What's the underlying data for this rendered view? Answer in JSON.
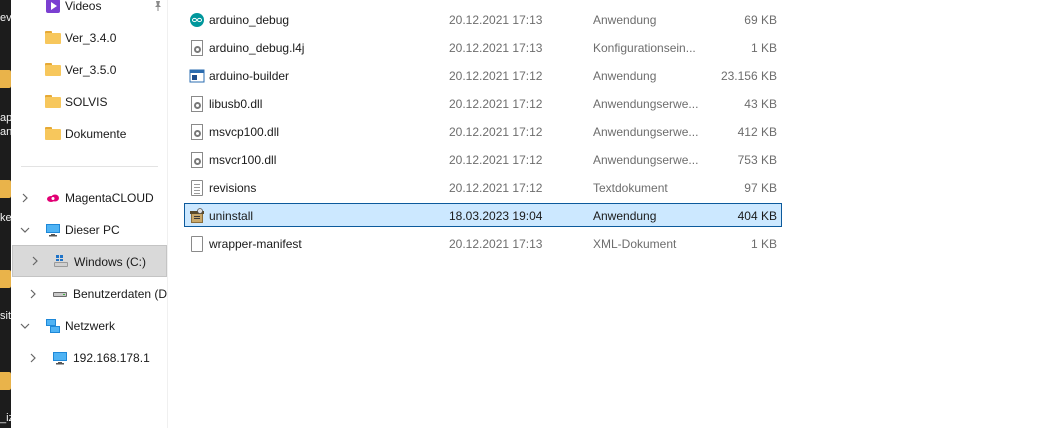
{
  "desktop": {
    "edge_text": [
      "ev",
      "ap",
      "an",
      "ke",
      "sit",
      "_iz"
    ]
  },
  "nav": {
    "quick_access": [
      {
        "label": "Videos",
        "icon": "videos-icon",
        "pinned": true
      },
      {
        "label": "Ver_3.4.0",
        "icon": "folder-icon"
      },
      {
        "label": "Ver_3.5.0",
        "icon": "folder-icon"
      },
      {
        "label": "SOLVIS",
        "icon": "folder-icon"
      },
      {
        "label": "Dokumente",
        "icon": "folder-icon"
      }
    ],
    "magentacloud": {
      "label": "MagentaCLOUD",
      "icon": "cloud-icon"
    },
    "this_pc": {
      "label": "Dieser PC",
      "icon": "monitor-icon"
    },
    "drives": [
      {
        "label": "Windows (C:)",
        "icon": "windows-drive-icon",
        "selected": true
      },
      {
        "label": "Benutzerdaten (D:",
        "icon": "drive-icon"
      }
    ],
    "network": {
      "label": "Netzwerk",
      "icon": "network-icon"
    },
    "network_hosts": [
      {
        "label": "192.168.178.1",
        "icon": "monitor-icon"
      }
    ],
    "pin_glyph": "📌"
  },
  "files": [
    {
      "name": "arduino_debug",
      "date": "20.12.2021 17:13",
      "type": "Anwendung",
      "size": "69 KB",
      "icon": "arduino-icon"
    },
    {
      "name": "arduino_debug.l4j",
      "date": "20.12.2021 17:13",
      "type": "Konfigurationsein...",
      "size": "1 KB",
      "icon": "config-file-icon"
    },
    {
      "name": "arduino-builder",
      "date": "20.12.2021 17:12",
      "type": "Anwendung",
      "size": "23.156 KB",
      "icon": "application-icon"
    },
    {
      "name": "libusb0.dll",
      "date": "20.12.2021 17:12",
      "type": "Anwendungserwe...",
      "size": "43 KB",
      "icon": "dll-icon"
    },
    {
      "name": "msvcp100.dll",
      "date": "20.12.2021 17:12",
      "type": "Anwendungserwe...",
      "size": "412 KB",
      "icon": "dll-icon"
    },
    {
      "name": "msvcr100.dll",
      "date": "20.12.2021 17:12",
      "type": "Anwendungserwe...",
      "size": "753 KB",
      "icon": "dll-icon"
    },
    {
      "name": "revisions",
      "date": "20.12.2021 17:12",
      "type": "Textdokument",
      "size": "97 KB",
      "icon": "text-file-icon"
    },
    {
      "name": "uninstall",
      "date": "18.03.2023 19:04",
      "type": "Anwendung",
      "size": "404 KB",
      "icon": "installer-icon",
      "selected": true
    },
    {
      "name": "wrapper-manifest",
      "date": "20.12.2021 17:13",
      "type": "XML-Dokument",
      "size": "1 KB",
      "icon": "xml-file-icon"
    }
  ],
  "colors": {
    "selection_bg": "#cce8ff",
    "selection_border": "#0c5a9c",
    "nav_selected_bg": "#d9d9d9",
    "folder": "#f7c75c",
    "secondary_text": "#6d6d6d"
  }
}
